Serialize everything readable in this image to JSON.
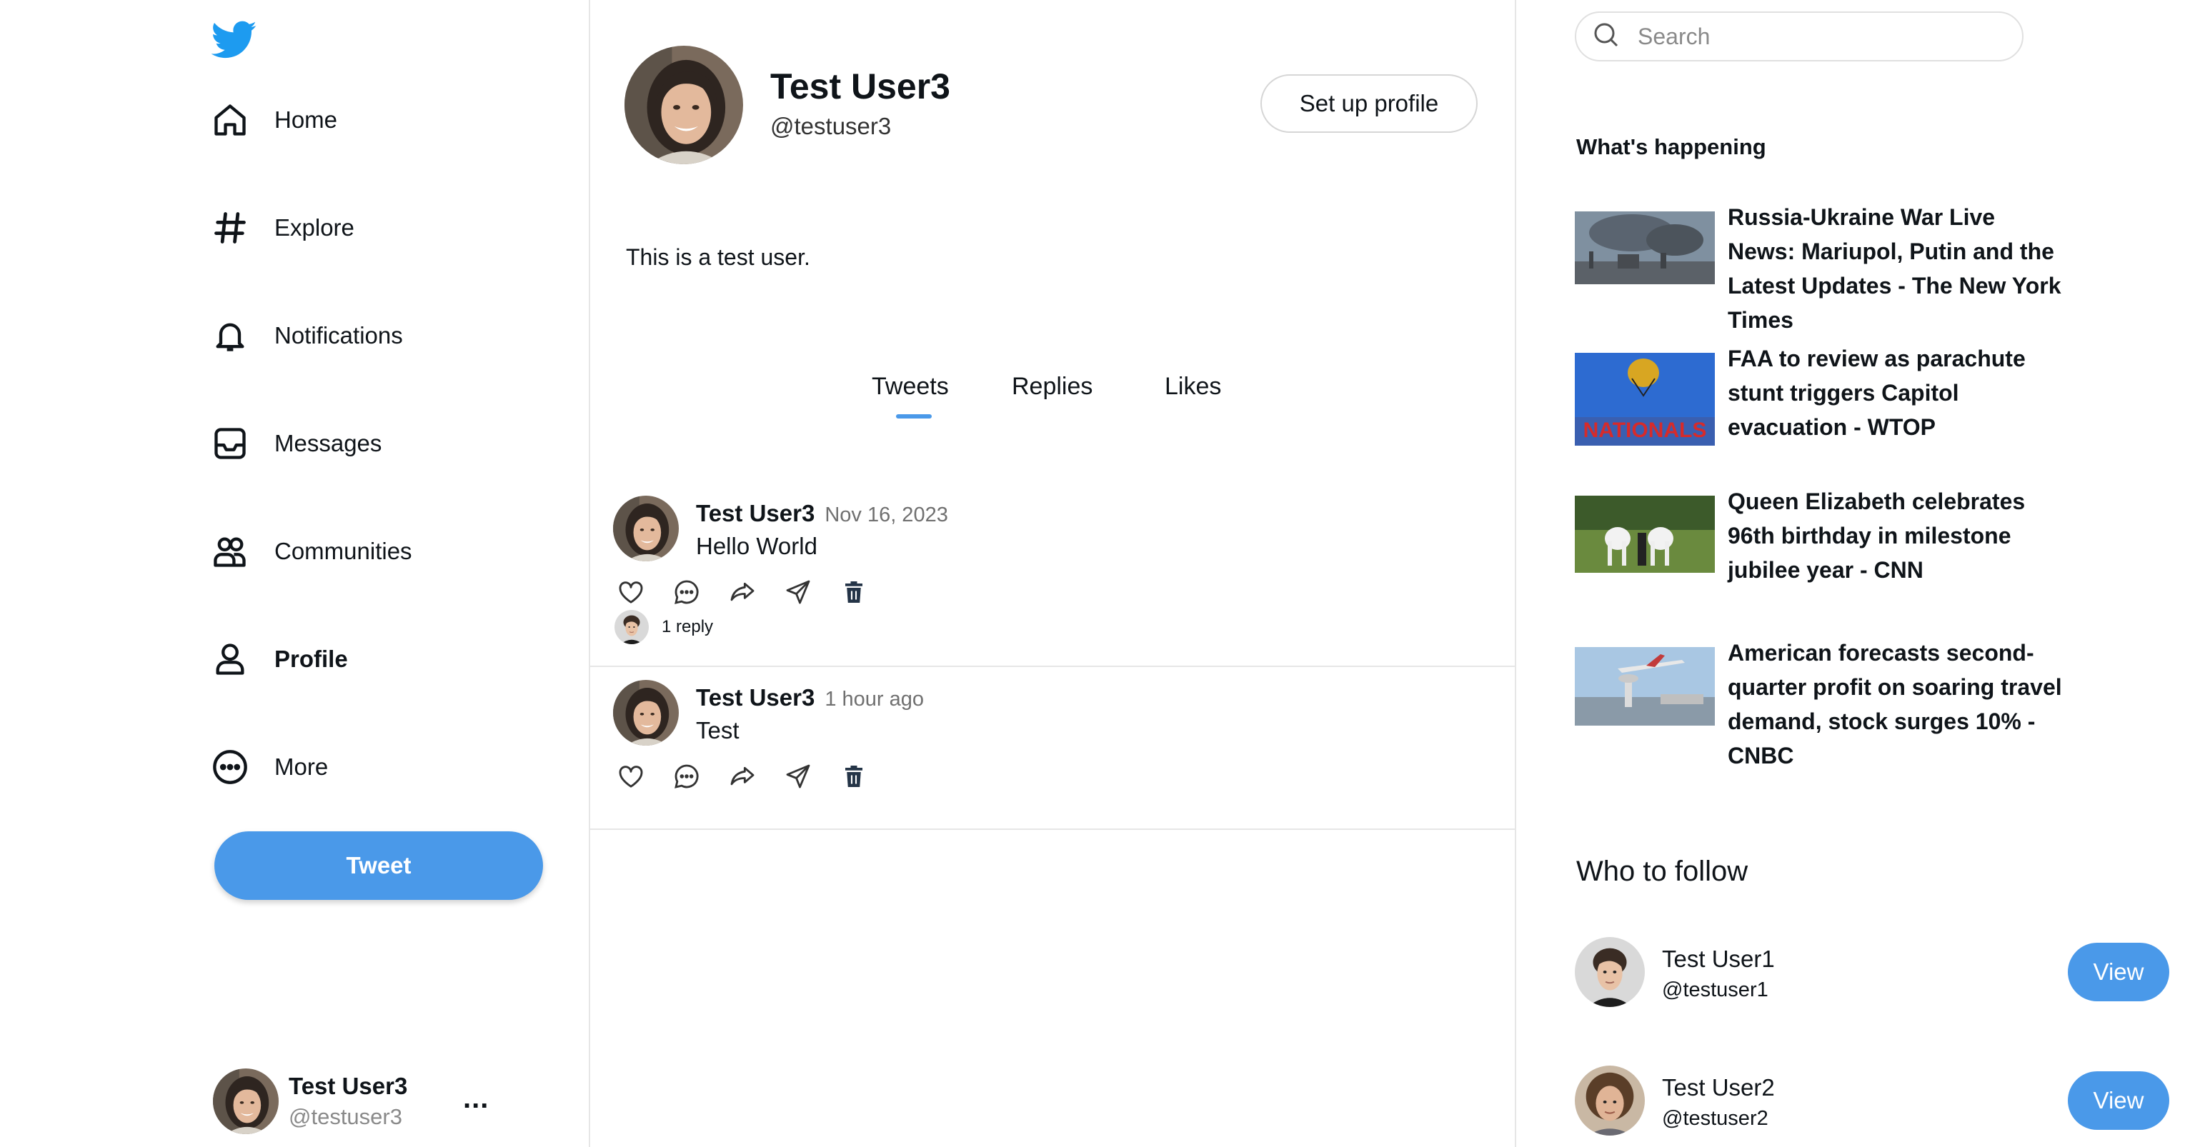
{
  "nav": {
    "logo": "twitter-bird-icon",
    "items": [
      {
        "label": "Home",
        "icon": "home-icon"
      },
      {
        "label": "Explore",
        "icon": "hashtag-icon"
      },
      {
        "label": "Notifications",
        "icon": "bell-icon"
      },
      {
        "label": "Messages",
        "icon": "inbox-icon"
      },
      {
        "label": "Communities",
        "icon": "people-icon"
      },
      {
        "label": "Profile",
        "icon": "user-icon",
        "active": true
      },
      {
        "label": "More",
        "icon": "more-circle-icon"
      }
    ],
    "tweet_button": "Tweet",
    "account": {
      "name": "Test User3",
      "handle": "@testuser3",
      "more": "..."
    }
  },
  "profile": {
    "name": "Test User3",
    "handle": "@testuser3",
    "setup_button": "Set up profile",
    "bio": "This is a test user.",
    "tabs": [
      "Tweets",
      "Replies",
      "Likes"
    ],
    "active_tab": "Tweets"
  },
  "tweets": [
    {
      "name": "Test User3",
      "time": "Nov 16, 2023",
      "text": "Hello World",
      "replies": "1 reply"
    },
    {
      "name": "Test User3",
      "time": "1 hour ago",
      "text": "Test"
    }
  ],
  "sidebar": {
    "search_placeholder": "Search",
    "happening_title": "What's happening",
    "news": [
      {
        "text": "Russia-Ukraine War Live News: Mariupol, Putin and the Latest Updates - The New York Times"
      },
      {
        "text": "FAA to review as parachute stunt triggers Capitol evacuation - WTOP"
      },
      {
        "text": "Queen Elizabeth celebrates 96th birthday in milestone jubilee year - CNN"
      },
      {
        "text": "American forecasts second-quarter profit on soaring travel demand, stock surges 10% - CNBC"
      }
    ],
    "who_to_follow_title": "Who to follow",
    "follow": [
      {
        "name": "Test User1",
        "handle": "@testuser1",
        "button": "View"
      },
      {
        "name": "Test User2",
        "handle": "@testuser2",
        "button": "View"
      }
    ]
  },
  "colors": {
    "accent": "#4a99e9",
    "twitter_blue": "#1d9bf0",
    "border": "#e6e6e6"
  }
}
